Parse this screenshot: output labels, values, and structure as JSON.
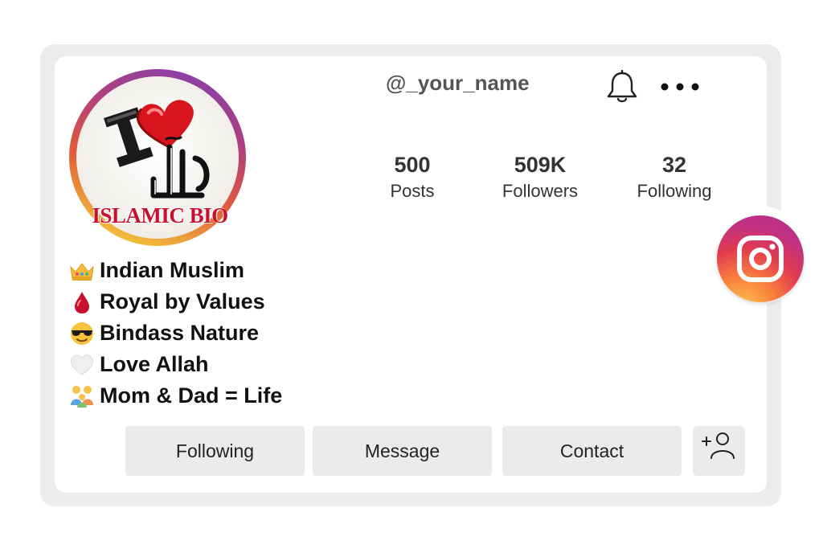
{
  "profile": {
    "username": "@_your_name",
    "avatar_caption": "ISLAMIC BIO",
    "avatar_text": "I",
    "avatar_icon": "heart-icon",
    "avatar_calligraphy": "الله"
  },
  "stats": [
    {
      "value": "500",
      "label": "Posts"
    },
    {
      "value": "509K",
      "label": "Followers"
    },
    {
      "value": "32",
      "label": "Following"
    }
  ],
  "bio": [
    {
      "icon": "crown-icon",
      "text": "Indian Muslim"
    },
    {
      "icon": "drop-icon",
      "text": "Royal by Values"
    },
    {
      "icon": "sunglasses-face-icon",
      "text": "Bindass Nature"
    },
    {
      "icon": "white-heart-icon",
      "text": "Love Allah"
    },
    {
      "icon": "family-icon",
      "text": "Mom & Dad = Life"
    }
  ],
  "actions": {
    "following_label": "Following",
    "message_label": "Message",
    "contact_label": "Contact",
    "add_friend_icon": "add-person-icon"
  },
  "icons": {
    "bell": "bell-icon",
    "more": "more-dots-icon",
    "instagram": "instagram-logo-icon"
  },
  "colors": {
    "caption": "#c8102e",
    "button_bg": "#ebebeb",
    "frame_bg": "#ececec"
  }
}
